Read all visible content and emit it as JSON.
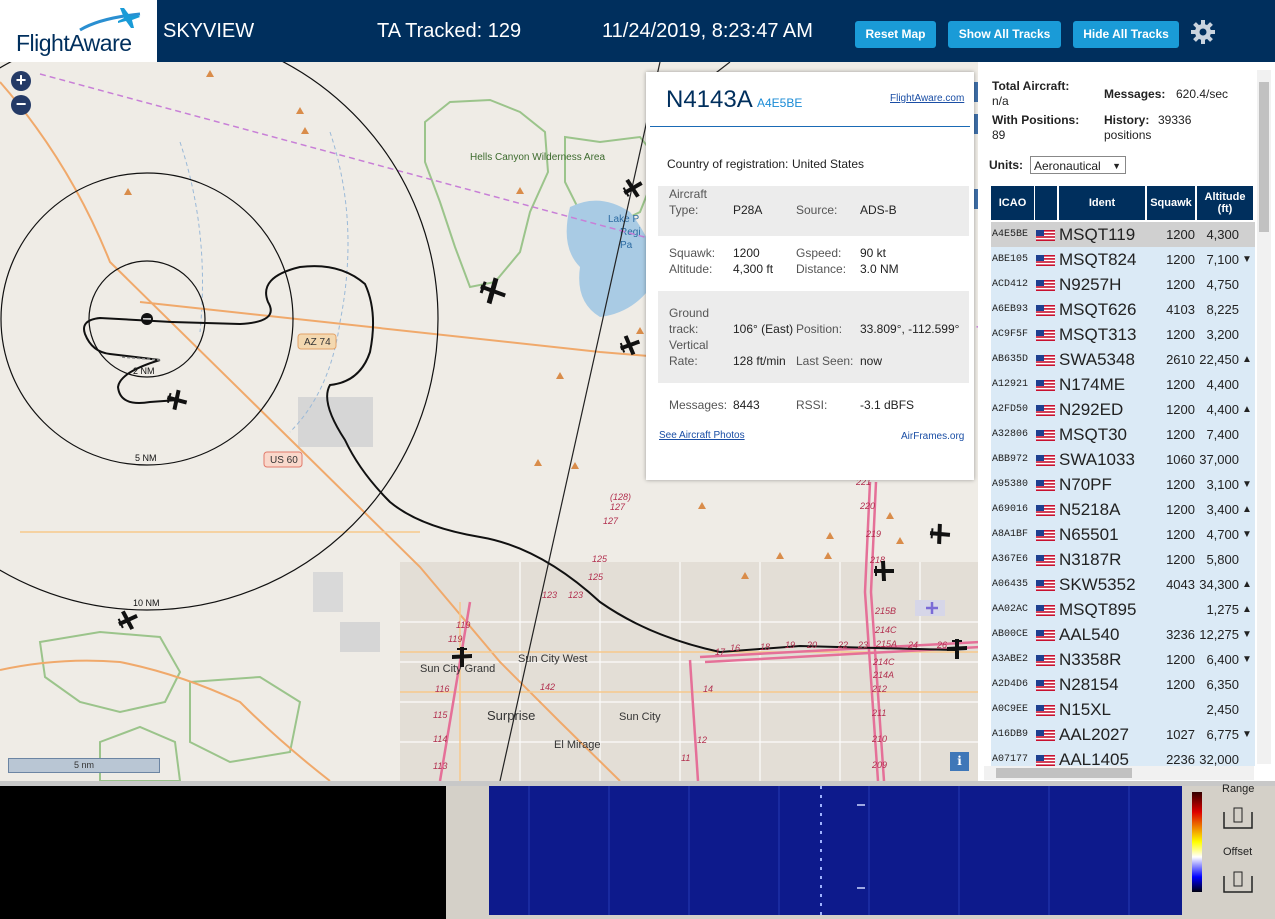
{
  "header": {
    "logo_text": "FlightAware",
    "app_title": "SKYVIEW",
    "tracked": "TA Tracked: 129",
    "datetime": "11/24/2019, 8:23:47 AM",
    "buttons": {
      "reset": "Reset Map",
      "show_all": "Show All Tracks",
      "hide_all": "Hide All Tracks"
    }
  },
  "map": {
    "zoom_in": "+",
    "zoom_out": "−",
    "scale": "5 nm",
    "info": "i",
    "range_labels": [
      "2 NM",
      "5 NM",
      "10 NM"
    ],
    "road_labels": [
      "AZ 74",
      "US 60"
    ],
    "place_labels": [
      "Hells Canyon Wilderness Area",
      "Lake P",
      "Regi",
      "Pa",
      "Sun City Grand",
      "Sun City West",
      "Surprise",
      "Sun City",
      "El Mirage"
    ],
    "mile_markers": [
      "(128)",
      "127",
      "127",
      "125",
      "125",
      "123",
      "123",
      "119",
      "119",
      "116",
      "115",
      "114",
      "113",
      "142",
      "17",
      "16",
      "18",
      "19",
      "20",
      "22",
      "23",
      "24",
      "26",
      "14",
      "12",
      "11",
      "221",
      "220",
      "219",
      "218",
      "215B",
      "214C",
      "215A",
      "214C",
      "214A",
      "212",
      "211",
      "210",
      "209"
    ]
  },
  "popup": {
    "title": "N4143A",
    "icao": "A4E5BE",
    "link": "FlightAware.com",
    "country_label": "Country of registration:",
    "country": "United States",
    "aircraft_type_label": "Aircraft Type:",
    "aircraft_type_label_1": "Aircraft",
    "aircraft_type_label_2": "Type:",
    "aircraft_type": "P28A",
    "source_label": "Source:",
    "source": "ADS-B",
    "squawk_label": "Squawk:",
    "squawk": "1200",
    "gspeed_label": "Gspeed:",
    "gspeed": "90 kt",
    "altitude_label": "Altitude:",
    "altitude": "4,300 ft",
    "distance_label": "Distance:",
    "distance": "3.0 NM",
    "ground_track_label_1": "Ground",
    "ground_track_label_2": "track:",
    "ground_track": "106° (East)",
    "position_label": "Position:",
    "position": "33.809°, -112.599°",
    "vertical_label_1": "Vertical",
    "vertical_label_2": "Rate:",
    "vertical_rate": "128 ft/min",
    "last_seen_label": "Last Seen:",
    "last_seen": "now",
    "messages_label": "Messages:",
    "messages": "8443",
    "rssi_label": "RSSI:",
    "rssi": "-3.1 dBFS",
    "photos_link": "See Aircraft Photos",
    "airframes_link": "AirFrames.org"
  },
  "stats": {
    "total_label": "Total Aircraft:",
    "total_value": "n/a",
    "messages_label": "Messages:",
    "messages_value": "620.4/sec",
    "positions_label": "With Positions:",
    "positions_value": "89",
    "history_label": "History:",
    "history_value": "39336",
    "history_unit": "positions",
    "units_label": "Units:",
    "units_value": "Aeronautical"
  },
  "table": {
    "headers": {
      "icao": "ICAO",
      "ident": "Ident",
      "squawk": "Squawk",
      "altitude": "Altitude (ft)"
    },
    "rows": [
      {
        "icao": "A4E5BE",
        "ident": "MSQT119",
        "squawk": "1200",
        "alt": "4,300",
        "arrow": ""
      },
      {
        "icao": "ABE105",
        "ident": "MSQT824",
        "squawk": "1200",
        "alt": "7,100",
        "arrow": "▼"
      },
      {
        "icao": "ACD412",
        "ident": "N9257H",
        "squawk": "1200",
        "alt": "4,750",
        "arrow": ""
      },
      {
        "icao": "A6EB93",
        "ident": "MSQT626",
        "squawk": "4103",
        "alt": "8,225",
        "arrow": ""
      },
      {
        "icao": "AC9F5F",
        "ident": "MSQT313",
        "squawk": "1200",
        "alt": "3,200",
        "arrow": ""
      },
      {
        "icao": "AB635D",
        "ident": "SWA5348",
        "squawk": "2610",
        "alt": "22,450",
        "arrow": "▲"
      },
      {
        "icao": "A12921",
        "ident": "N174ME",
        "squawk": "1200",
        "alt": "4,400",
        "arrow": ""
      },
      {
        "icao": "A2FD50",
        "ident": "N292ED",
        "squawk": "1200",
        "alt": "4,400",
        "arrow": "▲"
      },
      {
        "icao": "A32806",
        "ident": "MSQT30",
        "squawk": "1200",
        "alt": "7,400",
        "arrow": ""
      },
      {
        "icao": "ABB972",
        "ident": "SWA1033",
        "squawk": "1060",
        "alt": "37,000",
        "arrow": ""
      },
      {
        "icao": "A95380",
        "ident": "N70PF",
        "squawk": "1200",
        "alt": "3,100",
        "arrow": "▼"
      },
      {
        "icao": "A69016",
        "ident": "N5218A",
        "squawk": "1200",
        "alt": "3,400",
        "arrow": "▲"
      },
      {
        "icao": "A8A1BF",
        "ident": "N65501",
        "squawk": "1200",
        "alt": "4,700",
        "arrow": "▼"
      },
      {
        "icao": "A367E6",
        "ident": "N3187R",
        "squawk": "1200",
        "alt": "5,800",
        "arrow": ""
      },
      {
        "icao": "A06435",
        "ident": "SKW5352",
        "squawk": "4043",
        "alt": "34,300",
        "arrow": "▲"
      },
      {
        "icao": "AA02AC",
        "ident": "MSQT895",
        "squawk": "",
        "alt": "1,275",
        "arrow": "▲"
      },
      {
        "icao": "AB00CE",
        "ident": "AAL540",
        "squawk": "3236",
        "alt": "12,275",
        "arrow": "▼"
      },
      {
        "icao": "A3ABE2",
        "ident": "N3358R",
        "squawk": "1200",
        "alt": "6,400",
        "arrow": "▼"
      },
      {
        "icao": "A2D4D6",
        "ident": "N28154",
        "squawk": "1200",
        "alt": "6,350",
        "arrow": ""
      },
      {
        "icao": "A0C9EE",
        "ident": "N15XL",
        "squawk": "",
        "alt": "2,450",
        "arrow": ""
      },
      {
        "icao": "A16DB9",
        "ident": "AAL2027",
        "squawk": "1027",
        "alt": "6,775",
        "arrow": "▼"
      },
      {
        "icao": "A07177",
        "ident": "AAL1405",
        "squawk": "2236",
        "alt": "32,000",
        "arrow": ""
      }
    ]
  },
  "spectrum": {
    "range_label": "Range",
    "offset_label": "Offset"
  },
  "colors": {
    "header_bg": "#002f5d",
    "button_bg": "#1a9bd7",
    "row_alt": "#dbeaf6",
    "row_selected": "#d0d0d0"
  },
  "icons": [
    "plane-icon",
    "gear-icon",
    "zoom-in-icon",
    "zoom-out-icon",
    "info-icon",
    "us-flag-icon"
  ]
}
